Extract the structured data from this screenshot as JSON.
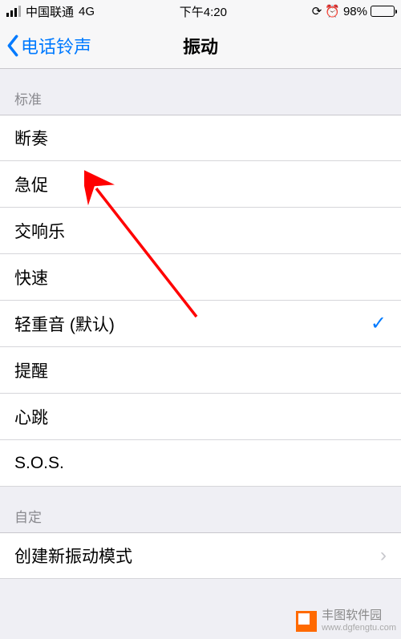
{
  "status": {
    "carrier": "中国联通",
    "network": "4G",
    "time": "下午4:20",
    "battery_pct": "98%"
  },
  "nav": {
    "back_label": "电话铃声",
    "title": "振动"
  },
  "sections": {
    "standard_header": "标准",
    "custom_header": "自定"
  },
  "standard_items": {
    "0": "断奏",
    "1": "急促",
    "2": "交响乐",
    "3": "快速",
    "4": "轻重音 (默认)",
    "5": "提醒",
    "6": "心跳",
    "7": "S.O.S."
  },
  "custom_items": {
    "0": "创建新振动模式"
  },
  "selected_index": 4,
  "watermark": {
    "title": "丰图软件园",
    "url": "www.dgfengtu.com"
  }
}
